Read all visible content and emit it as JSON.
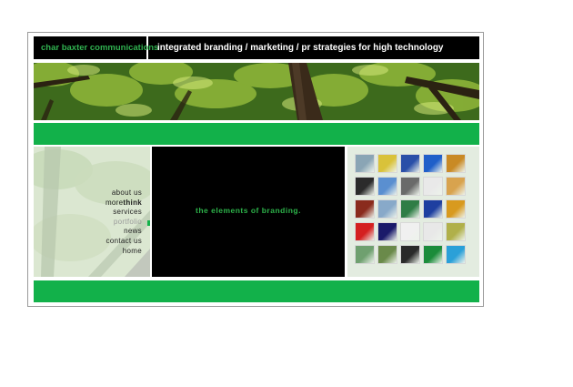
{
  "header": {
    "brand": "char baxter communications",
    "tagline": "integrated branding / marketing / pr strategies for high technology"
  },
  "nav": {
    "items": [
      {
        "label": "about us"
      },
      {
        "label_prefix": "more",
        "label_bold": "think"
      },
      {
        "label": "services"
      },
      {
        "label": "portfolio"
      },
      {
        "label": "news"
      },
      {
        "label": "contact us"
      },
      {
        "label": "home"
      }
    ],
    "active_item": "portfolio"
  },
  "main": {
    "headline": "the elements of branding."
  },
  "portfolio_grid": {
    "rows": 5,
    "columns": 5,
    "thumbnail_colors": [
      "#8aa5b5",
      "#d9c23a",
      "#2a4fa8",
      "#1f5fc9",
      "#c98a25",
      "#2b2b2b",
      "#5a8fd0",
      "#6a6a6a",
      "#e9e9e9",
      "#d8a34e",
      "#8a2b1d",
      "#88a9c9",
      "#2f7d46",
      "#1e3fa0",
      "#d89a1f",
      "#d42020",
      "#1a1a6a",
      "#f0f0f0",
      "#e8e8e8",
      "#b0b04a",
      "#6fa06f",
      "#6a8a4a",
      "#2a2a2a",
      "#1b8c3a",
      "#2aa0d8"
    ]
  },
  "colors": {
    "accent_green": "#12b14a",
    "header_black": "#000000",
    "brand_text": "#30b250"
  }
}
